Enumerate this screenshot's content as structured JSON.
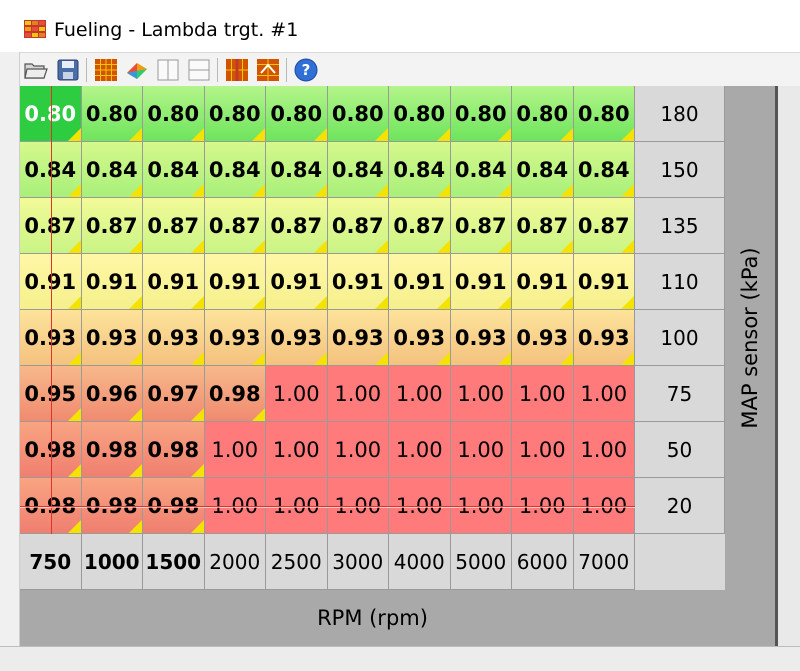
{
  "window": {
    "title": "Fueling - Lambda trgt. #1",
    "icon": "table-app-icon"
  },
  "toolbar": {
    "buttons": [
      {
        "name": "open-folder-icon"
      },
      {
        "name": "save-icon"
      },
      {
        "name": "grid-view-icon"
      },
      {
        "name": "3d-view-icon"
      },
      {
        "name": "split-vertical-icon"
      },
      {
        "name": "split-horizontal-icon"
      },
      {
        "name": "interpolate-columns-icon"
      },
      {
        "name": "interpolate-rows-icon"
      },
      {
        "name": "help-icon"
      }
    ]
  },
  "table": {
    "y_axis_label": "MAP sensor (kPa)",
    "x_axis_label": "RPM (rpm)",
    "y_axis_values": [
      "180",
      "150",
      "135",
      "110",
      "100",
      "75",
      "50",
      "20"
    ],
    "x_axis_values": [
      "750",
      "1000",
      "1500",
      "2000",
      "2500",
      "3000",
      "4000",
      "5000",
      "6000",
      "7000"
    ],
    "x_axis_bold": [
      true,
      true,
      true,
      false,
      false,
      false,
      false,
      false,
      false,
      false
    ],
    "rows": [
      [
        "0.80",
        "0.80",
        "0.80",
        "0.80",
        "0.80",
        "0.80",
        "0.80",
        "0.80",
        "0.80",
        "0.80"
      ],
      [
        "0.84",
        "0.84",
        "0.84",
        "0.84",
        "0.84",
        "0.84",
        "0.84",
        "0.84",
        "0.84",
        "0.84"
      ],
      [
        "0.87",
        "0.87",
        "0.87",
        "0.87",
        "0.87",
        "0.87",
        "0.87",
        "0.87",
        "0.87",
        "0.87"
      ],
      [
        "0.91",
        "0.91",
        "0.91",
        "0.91",
        "0.91",
        "0.91",
        "0.91",
        "0.91",
        "0.91",
        "0.91"
      ],
      [
        "0.93",
        "0.93",
        "0.93",
        "0.93",
        "0.93",
        "0.93",
        "0.93",
        "0.93",
        "0.93",
        "0.93"
      ],
      [
        "0.95",
        "0.96",
        "0.97",
        "0.98",
        "1.00",
        "1.00",
        "1.00",
        "1.00",
        "1.00",
        "1.00"
      ],
      [
        "0.98",
        "0.98",
        "0.98",
        "1.00",
        "1.00",
        "1.00",
        "1.00",
        "1.00",
        "1.00",
        "1.00"
      ],
      [
        "0.98",
        "0.98",
        "0.98",
        "1.00",
        "1.00",
        "1.00",
        "1.00",
        "1.00",
        "1.00",
        "1.00"
      ]
    ],
    "row_gradients": [
      [
        "#b4f58a",
        "#6ee45d"
      ],
      [
        "#d6f88c",
        "#a8f07a"
      ],
      [
        "#f3fa98",
        "#c9f485"
      ],
      [
        "#fff7a6",
        "#f5f08c"
      ],
      [
        "#fde39a",
        "#f4c27f"
      ],
      [
        "#f7b98a",
        "#f08a70"
      ],
      [
        "#f8a482",
        "#f07f70"
      ],
      [
        "#f8a482",
        "#f07f70"
      ]
    ],
    "cell_flat_color": "#ff7b7b",
    "modified_marker_color": "#f4e300",
    "selected_cell": {
      "row": 0,
      "col": 0,
      "color": "#2ecc40"
    }
  }
}
